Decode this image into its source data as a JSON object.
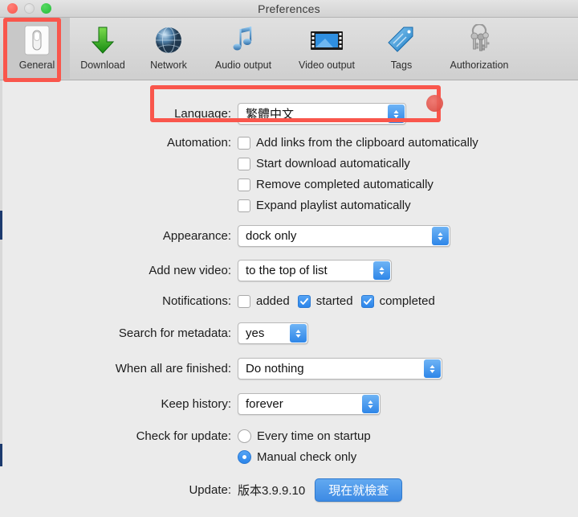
{
  "window": {
    "title": "Preferences",
    "traffic_lights": [
      "close",
      "minimize",
      "zoom"
    ]
  },
  "toolbar": {
    "items": [
      {
        "id": "general",
        "label": "General",
        "icon": "switch-icon",
        "selected": true
      },
      {
        "id": "download",
        "label": "Download",
        "icon": "down-arrow-icon",
        "selected": false
      },
      {
        "id": "network",
        "label": "Network",
        "icon": "globe-icon",
        "selected": false
      },
      {
        "id": "audio-output",
        "label": "Audio output",
        "icon": "music-note-icon",
        "selected": false
      },
      {
        "id": "video-output",
        "label": "Video output",
        "icon": "film-strip-icon",
        "selected": false
      },
      {
        "id": "tags",
        "label": "Tags",
        "icon": "tag-icon",
        "selected": false
      },
      {
        "id": "authorization",
        "label": "Authorization",
        "icon": "keys-icon",
        "selected": false
      }
    ]
  },
  "form": {
    "language": {
      "label": "Language:",
      "value": "繁體中文"
    },
    "automation": {
      "label": "Automation:",
      "options": [
        {
          "label": "Add links from the clipboard automatically",
          "checked": false
        },
        {
          "label": "Start download automatically",
          "checked": false
        },
        {
          "label": "Remove completed automatically",
          "checked": false
        },
        {
          "label": "Expand playlist automatically",
          "checked": false
        }
      ]
    },
    "appearance": {
      "label": "Appearance:",
      "value": "dock only"
    },
    "add_new_video": {
      "label": "Add new video:",
      "value": "to the top of list"
    },
    "notifications": {
      "label": "Notifications:",
      "options": [
        {
          "label": "added",
          "checked": false
        },
        {
          "label": "started",
          "checked": true
        },
        {
          "label": "completed",
          "checked": true
        }
      ]
    },
    "search_metadata": {
      "label": "Search for metadata:",
      "value": "yes"
    },
    "when_finished": {
      "label": "When all are finished:",
      "value": "Do nothing"
    },
    "keep_history": {
      "label": "Keep history:",
      "value": "forever"
    },
    "check_for_update": {
      "label": "Check for update:",
      "options": [
        {
          "label": "Every time on startup",
          "selected": false
        },
        {
          "label": "Manual check only",
          "selected": true
        }
      ]
    },
    "update": {
      "label": "Update:",
      "version": "版本3.9.9.10",
      "button_label": "現在就檢查"
    }
  },
  "annotations": {
    "highlight_color": "#f9564c",
    "boxes": [
      "general-toolbar-item",
      "language-row"
    ],
    "badge": "red-circle-marker"
  },
  "colors": {
    "accent_blue": "#2e86e8",
    "window_bg": "#ebebeb",
    "toolbar_bg": "#d6d6d6",
    "annotation_red": "#f9564c"
  }
}
